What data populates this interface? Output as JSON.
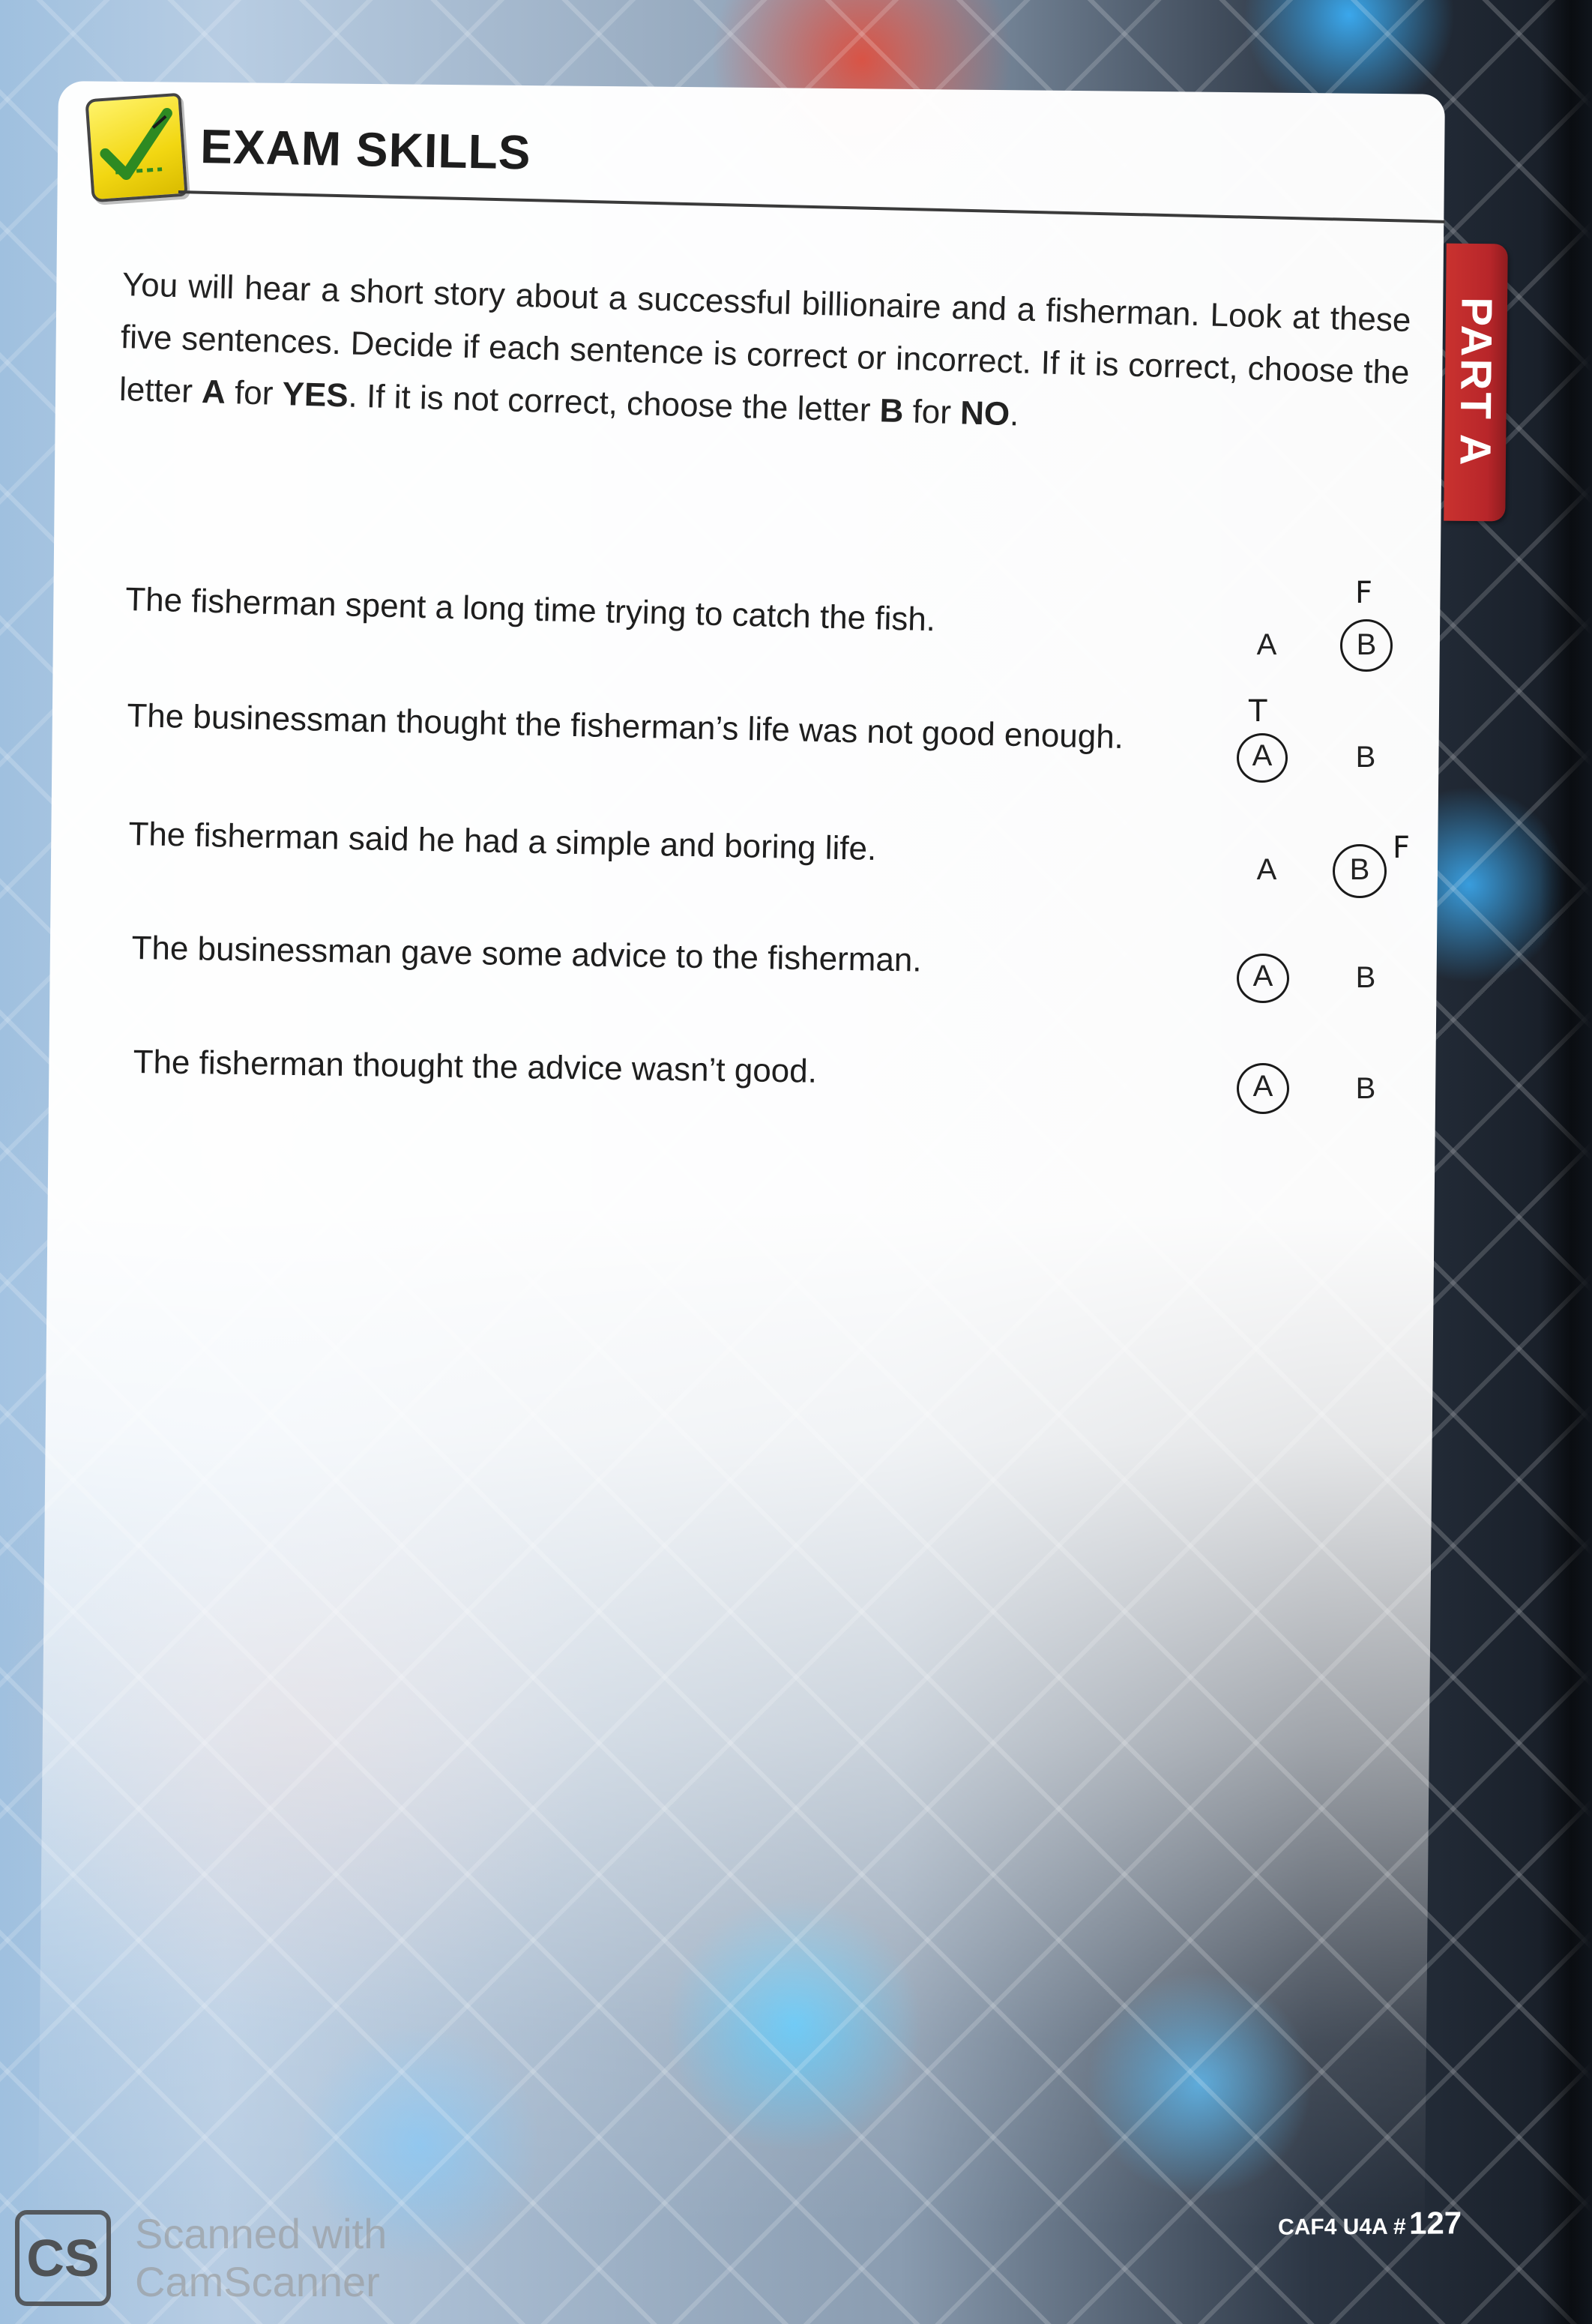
{
  "header": {
    "title": "EXAM SKILLS",
    "part_tab": "PART A"
  },
  "instructions": {
    "s1": "You will hear a short story about a successful billionaire and a fisherman. Look at these five sentences. Decide if each sentence is correct or incorrect. If it is correct, choose the letter ",
    "letter_a": "A",
    "s2": " for ",
    "yes": "YES",
    "s3": ". If it is not correct, choose the letter ",
    "letter_b": "B",
    "s4": " for ",
    "no": "NO",
    "s5": "."
  },
  "questions": [
    {
      "text": "The fisherman spent a long time trying to catch the fish.",
      "option_a": "A",
      "option_b": "B",
      "circled": "B",
      "handwritten": "F"
    },
    {
      "text": "The businessman thought the fisherman’s life was not good enough.",
      "option_a": "A",
      "option_b": "B",
      "circled": "A",
      "handwritten": "T"
    },
    {
      "text": "The fisherman said he had a simple and boring life.",
      "option_a": "A",
      "option_b": "B",
      "circled": "B",
      "handwritten": "F"
    },
    {
      "text": "The businessman gave some advice to the fisherman.",
      "option_a": "A",
      "option_b": "B",
      "circled": "A",
      "handwritten": ""
    },
    {
      "text": "The fisherman thought the advice wasn’t good.",
      "option_a": "A",
      "option_b": "B",
      "circled": "A",
      "handwritten": ""
    }
  ],
  "footer": {
    "code": "CAF4 U4A #",
    "page": "127"
  },
  "watermark": {
    "badge": "CS",
    "line1": "Scanned with",
    "line2": "CamScanner"
  },
  "colors": {
    "part_tab": "#c9322f",
    "logo_yellow": "#f2d712",
    "check_green": "#3a9a2a"
  }
}
